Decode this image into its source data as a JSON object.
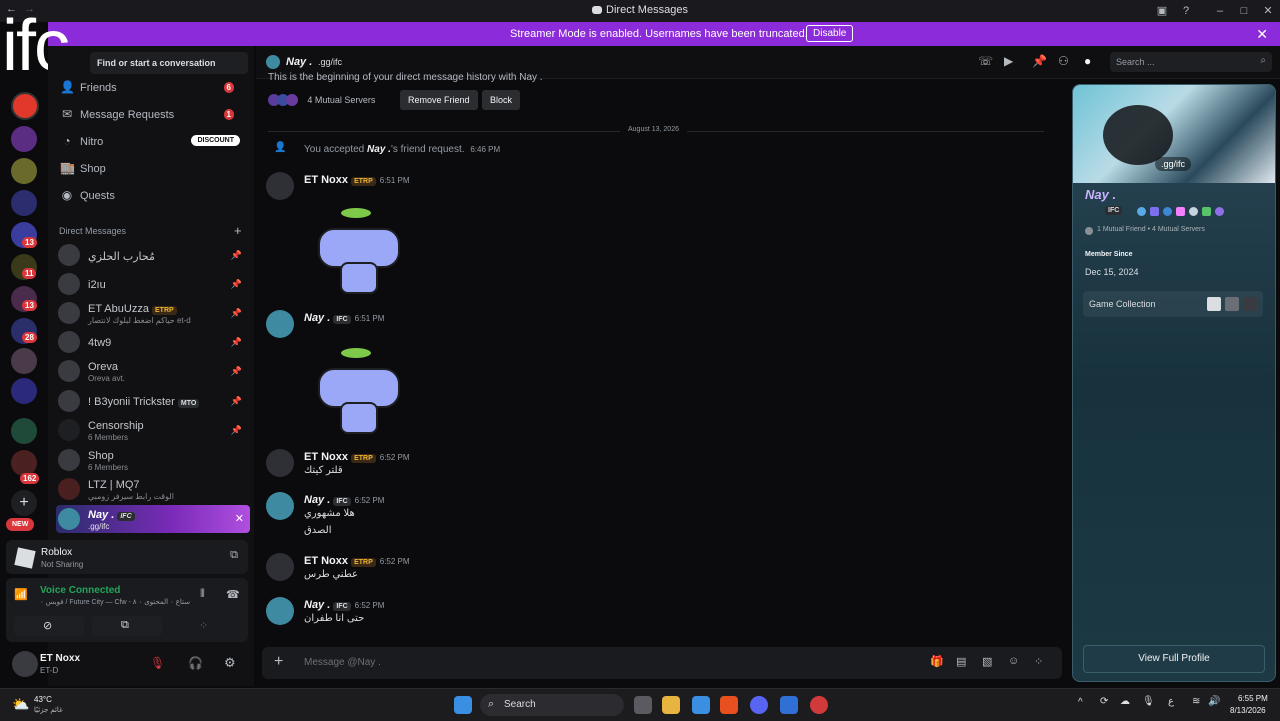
{
  "window": {
    "title": "Direct Messages"
  },
  "banner": {
    "message": "Streamer Mode is enabled. Usernames have been truncated.",
    "disable_label": "Disable"
  },
  "overlay_text": "ifc",
  "sidebar": {
    "search_placeholder": "Find or start a conversation",
    "nav": [
      {
        "label": "Friends",
        "badge": "6"
      },
      {
        "label": "Message Requests",
        "badge": "1"
      },
      {
        "label": "Nitro",
        "badge": "DISCOUNT"
      },
      {
        "label": "Shop"
      },
      {
        "label": "Quests"
      }
    ],
    "dm_header": "Direct Messages",
    "dms": [
      {
        "name": "مُحارب الحلزي",
        "sub": ""
      },
      {
        "name": "i2ıu",
        "sub": ""
      },
      {
        "name": "ET AbuUzza",
        "tag": "ETRP",
        "sub": "حياكم اضغط لبلوك لانتصار et-d"
      },
      {
        "name": "4tw9",
        "sub": ""
      },
      {
        "name": "Oreva",
        "sub": "Oreva avt."
      },
      {
        "name": "! B3yonii Trickster",
        "tag": "MTO",
        "sub": ""
      },
      {
        "name": "Censorship",
        "sub": "6 Members"
      },
      {
        "name": "Shop",
        "sub": "6 Members"
      },
      {
        "name": "LTZ | MQ7",
        "sub": "الوقت رابط سيرفر زومبي"
      },
      {
        "name": "Nay .",
        "tag": "IFC",
        "sub": ".gg/ifc"
      }
    ],
    "activity": {
      "game": "Roblox",
      "status": "Not Sharing"
    },
    "voice": {
      "title": "Voice Connected",
      "channel": "فويس ٠ / Future City — Cfw - ستاع ٠ المحتوى ٠ ٨"
    },
    "user": {
      "name": "ET Noxx",
      "status": "ET-D"
    },
    "new_label": "NEW"
  },
  "rail_badges": [
    "11",
    "13",
    "28",
    "162"
  ],
  "header": {
    "name": "Nay .",
    "handle": ".gg/ifc",
    "search_placeholder": "Search ..."
  },
  "chat": {
    "intro": "This is the beginning of your direct message history with Nay .",
    "mutual_servers": "4 Mutual Servers",
    "remove_friend": "Remove Friend",
    "block": "Block",
    "date_divider": "August 13, 2026",
    "system": {
      "text_prefix": "You accepted",
      "name": "Nay .",
      "text_suffix": "'s friend request.",
      "time": "6:46 PM"
    },
    "messages": [
      {
        "author": "ET Noxx",
        "tag": "ETRP",
        "time": "6:51 PM",
        "text": ""
      },
      {
        "author": "Nay .",
        "tag": "IFC",
        "time": "6:51 PM",
        "text": ""
      },
      {
        "author": "ET Noxx",
        "tag": "ETRP",
        "time": "6:52 PM",
        "text": "قلتر كيتك"
      },
      {
        "author": "Nay .",
        "tag": "IFC",
        "time": "6:52 PM",
        "text": "هلا مشهوري",
        "text2": "الصدق"
      },
      {
        "author": "ET Noxx",
        "tag": "ETRP",
        "time": "6:52 PM",
        "text": "عطني طرس"
      },
      {
        "author": "Nay .",
        "tag": "IFC",
        "time": "6:52 PM",
        "text": "حتى انا طفران"
      }
    ],
    "input_placeholder": "Message @Nay ."
  },
  "profile": {
    "banner_text": ".gg/ifc",
    "name": "Nay .",
    "tag": "IFC",
    "mutuals": "1 Mutual Friend • 4 Mutual Servers",
    "member_since_label": "Member Since",
    "member_since": "Dec 15, 2024",
    "game_collection": "Game Collection",
    "view_full": "View Full Profile"
  },
  "taskbar": {
    "weather_temp": "43°C",
    "weather_desc": "غائم جزئيًا",
    "search": "Search",
    "time": "6:55 PM",
    "date": "8/13/2026",
    "lang": "ع"
  },
  "colors": {
    "accent": "#8c2bd9",
    "blurple": "#5865f2",
    "online": "#23a55a",
    "danger": "#da373c"
  }
}
